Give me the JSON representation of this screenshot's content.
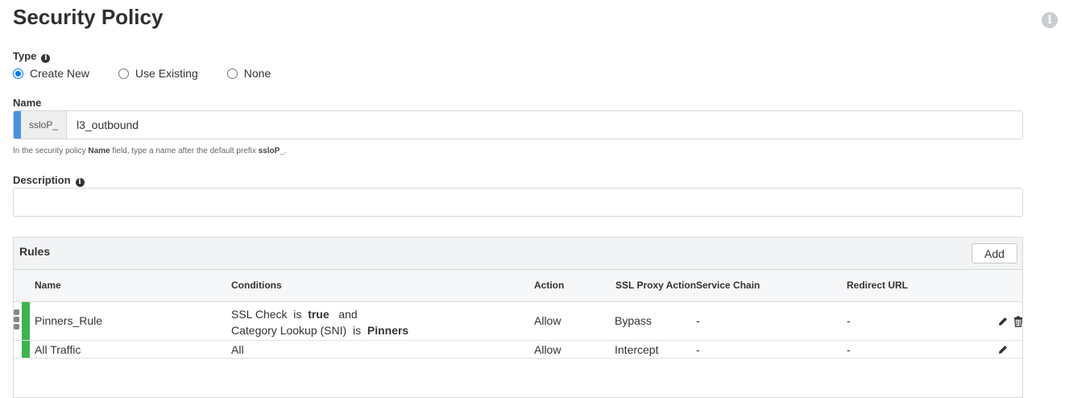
{
  "page": {
    "title": "Security Policy"
  },
  "type_field": {
    "label": "Type",
    "info_icon": "info-icon",
    "options": [
      {
        "label": "Create New",
        "selected": true
      },
      {
        "label": "Use Existing",
        "selected": false
      },
      {
        "label": "None",
        "selected": false
      }
    ]
  },
  "name_field": {
    "label": "Name",
    "prefix": "ssloP_",
    "value": "l3_outbound",
    "hint": {
      "pre": "In the security policy ",
      "strong1": "Name",
      "mid": " field, type a name after the default prefix ",
      "strong2": "ssloP_",
      "post": "."
    }
  },
  "description_field": {
    "label": "Description",
    "value": ""
  },
  "rules": {
    "title": "Rules",
    "add_label": "Add",
    "columns": [
      "Name",
      "Conditions",
      "Action",
      "SSL Proxy Action",
      "Service Chain",
      "Redirect URL"
    ],
    "rows": [
      {
        "name": "Pinners_Rule",
        "conditions": [
          {
            "pre": "SSL Check  is  ",
            "value": "true",
            "post": "   and"
          },
          {
            "pre": "Category Lookup (SNI)  is  ",
            "value": "Pinners",
            "post": ""
          }
        ],
        "action": "Allow",
        "ssl_proxy_action": "Bypass",
        "service_chain": "-",
        "redirect_url": "-",
        "actions": [
          "edit-icon",
          "delete-icon"
        ]
      },
      {
        "name": "All Traffic",
        "conditions_text": "All",
        "action": "Allow",
        "ssl_proxy_action": "Intercept",
        "service_chain": "-",
        "redirect_url": "-",
        "actions": [
          "edit-icon"
        ]
      }
    ]
  },
  "colors": {
    "accent": "#4a90e2",
    "rule_bar": "#3cb44b",
    "radio": "#0075ff"
  }
}
